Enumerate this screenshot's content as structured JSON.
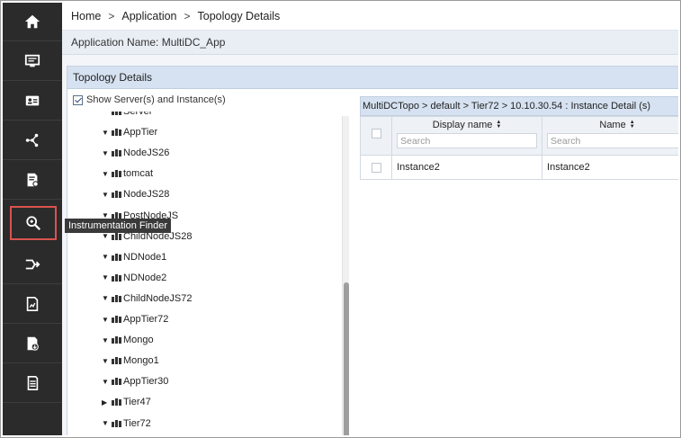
{
  "breadcrumb": {
    "items": [
      "Home",
      "Application",
      "Topology Details"
    ],
    "separator": ">"
  },
  "app": {
    "name_label": "Application Name: MultiDC_App"
  },
  "sidebar": {
    "items": [
      {
        "icon": "home-icon"
      },
      {
        "icon": "monitor-dashboard-icon"
      },
      {
        "icon": "id-card-icon"
      },
      {
        "icon": "topology-icon"
      },
      {
        "icon": "report-settings-icon"
      },
      {
        "icon": "instrumentation-finder-icon"
      },
      {
        "icon": "flow-icon"
      },
      {
        "icon": "document-chart-icon"
      },
      {
        "icon": "download-report-icon"
      },
      {
        "icon": "list-report-icon"
      }
    ],
    "tooltip": "Instrumentation Finder",
    "accent": "#d9534f",
    "background": "#2b2b2b"
  },
  "panel": {
    "title": "Topology Details",
    "show_server_label": "Show Server(s) and Instance(s)",
    "show_server_checked": true,
    "tree": [
      {
        "label": "Server",
        "caret": ""
      },
      {
        "label": "AppTier",
        "caret": "▼"
      },
      {
        "label": "NodeJS26",
        "caret": "▼"
      },
      {
        "label": "tomcat",
        "caret": "▼"
      },
      {
        "label": "NodeJS28",
        "caret": "▼"
      },
      {
        "label": "PostNodeJS",
        "caret": "▼"
      },
      {
        "label": "ChildNodeJS28",
        "caret": "▼"
      },
      {
        "label": "NDNode1",
        "caret": "▼"
      },
      {
        "label": "NDNode2",
        "caret": "▼"
      },
      {
        "label": "ChildNodeJS72",
        "caret": "▼"
      },
      {
        "label": "AppTier72",
        "caret": "▼"
      },
      {
        "label": "Mongo",
        "caret": "▼"
      },
      {
        "label": "Mongo1",
        "caret": "▼"
      },
      {
        "label": "AppTier30",
        "caret": "▼"
      },
      {
        "label": "Tier47",
        "caret": "▶"
      },
      {
        "label": "Tier72",
        "caret": "▼"
      }
    ]
  },
  "detail": {
    "title": "MultiDCTopo > default > Tier72 > 10.10.30.54 : Instance Detail (s)",
    "columns": [
      {
        "label": "Display name",
        "search_placeholder": "Search"
      },
      {
        "label": "Name",
        "search_placeholder": "Search"
      }
    ],
    "rows": [
      {
        "display_name": "Instance2",
        "name": "Instance2"
      }
    ]
  }
}
